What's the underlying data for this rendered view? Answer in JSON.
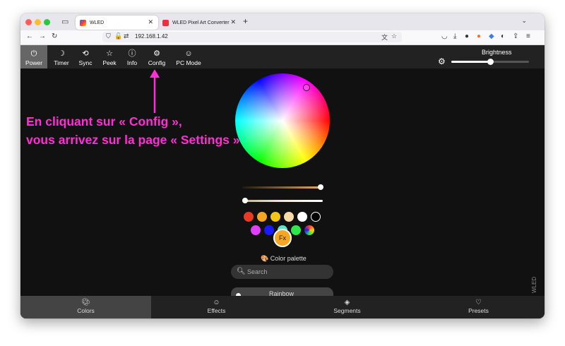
{
  "browser": {
    "tabs": [
      {
        "label": "WLED",
        "active": true
      },
      {
        "label": "WLED Pixel Art Converter",
        "active": false
      }
    ],
    "url": "192.168.1.42"
  },
  "app": {
    "topnav": [
      {
        "label": "Power",
        "icon": "power-icon",
        "active": true
      },
      {
        "label": "Timer",
        "icon": "moon-icon"
      },
      {
        "label": "Sync",
        "icon": "sync-icon"
      },
      {
        "label": "Peek",
        "icon": "star-icon"
      },
      {
        "label": "Info",
        "icon": "info-icon"
      },
      {
        "label": "Config",
        "icon": "gear-icon"
      },
      {
        "label": "PC Mode",
        "icon": "smiley-icon"
      }
    ],
    "brightness": {
      "label": "Brightness",
      "value": 0.5
    },
    "color_sliders": {
      "kelvin": 1.0,
      "white": 0.0
    },
    "swatches_row1": [
      "#e83a24",
      "#f5a623",
      "#f5c518",
      "#f7dba7",
      "#ffffff",
      "#000000"
    ],
    "swatches_row2": [
      "#e040fb",
      "#1a1aff",
      "#5ce6c8",
      "#2ee84a",
      "random"
    ],
    "fx_label": "Fx",
    "palette_title": "Color palette",
    "search_placeholder": "Search",
    "palette_first": "Rainbow",
    "watermark": "WLED",
    "bottomnav": [
      {
        "label": "Colors",
        "icon": "palette-icon",
        "active": true
      },
      {
        "label": "Effects",
        "icon": "smiley-icon"
      },
      {
        "label": "Segments",
        "icon": "layers-icon"
      },
      {
        "label": "Presets",
        "icon": "heart-icon"
      }
    ]
  },
  "annotation": {
    "line1": "En cliquant sur « Config »,",
    "line2": "vous arrivez sur la page « Settings »",
    "color": "#ff2fd5"
  }
}
